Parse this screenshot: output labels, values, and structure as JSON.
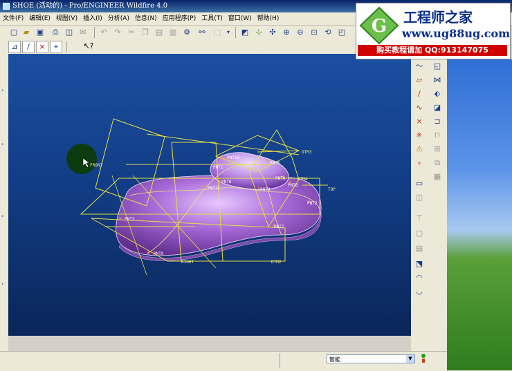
{
  "window": {
    "title": "SHOE (活动的) - Pro/ENGINEER Wildfire 4.0"
  },
  "menu": [
    "文件(F)",
    "编辑(E)",
    "视图(V)",
    "插入(I)",
    "分析(A)",
    "信息(N)",
    "应用程序(P)",
    "工具(T)",
    "窗口(W)",
    "帮助(H)"
  ],
  "banner": {
    "name": "工程师之家",
    "url": "www.ug88ug.com",
    "promo": "购买教程请加 QQ:913147075"
  },
  "toolbar": {
    "top_icons": [
      "new-icon",
      "open-icon",
      "save-icon",
      "print-icon",
      "preview-icon",
      "email-icon",
      "undo-icon",
      "redo-icon",
      "cut-icon",
      "copy-icon",
      "paste-icon",
      "paste-special-icon",
      "regenerate-icon",
      "find-icon",
      "select-box-icon",
      "repaint-icon",
      "spin-center-icon",
      "orient-icon",
      "zoom-in-icon",
      "zoom-out-icon",
      "refit-icon",
      "orient2-icon",
      "saved-views-icon",
      "layers-icon"
    ],
    "datum_icons": [
      "datum-plane-display-icon",
      "datum-axis-display-icon",
      "datum-point-display-icon",
      "csys-display-icon"
    ],
    "context_help_icon": "context-help-icon"
  },
  "viewport": {
    "labels": {
      "front": "FRONT",
      "right": "RIGHT",
      "top": "TOP",
      "dtm2": "DTM2",
      "dtm3": "DTM3",
      "dtm4": "DTM4",
      "pnt0": "PNT0",
      "pnt1": "PNT1",
      "pnt2": "PNT2",
      "pnt3": "PNT3",
      "pnt4": "PNT4",
      "pnt5": "PNT5",
      "pnt6": "PNT6",
      "pnt7": "PNT7",
      "pnt8": "PNT8",
      "pnt9": "PNT9",
      "pnt10": "PNT10",
      "pnt11": "PNT11"
    }
  },
  "status": {
    "filter_value": "智能"
  }
}
